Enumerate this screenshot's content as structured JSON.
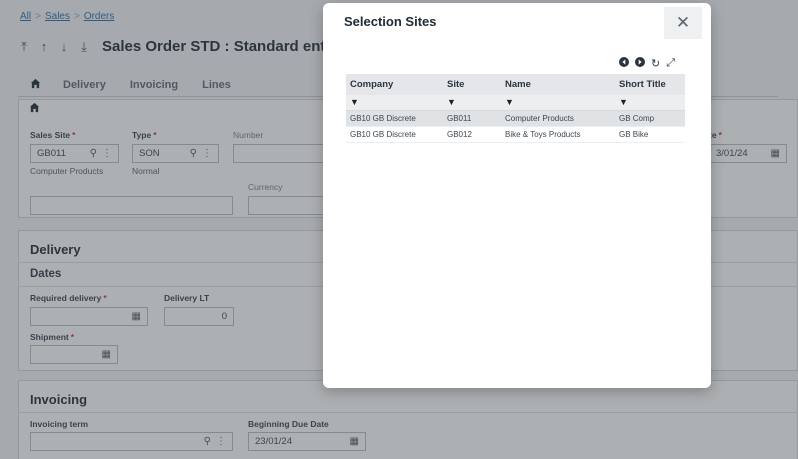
{
  "breadcrumb": {
    "all": "All",
    "sales": "Sales",
    "orders": "Orders",
    "sep": ">"
  },
  "header": {
    "title": "Sales Order STD : Standard entry"
  },
  "tabs": [
    {
      "label": "Delivery"
    },
    {
      "label": "Invoicing"
    },
    {
      "label": "Lines"
    }
  ],
  "form": {
    "sales_site_label": "Sales Site",
    "sales_site_value": "GB011",
    "sales_site_desc": "Computer Products",
    "type_label": "Type",
    "type_value": "SON",
    "type_desc": "Normal",
    "number_label": "Number",
    "currency_label": "Currency",
    "date_label": "te",
    "date_value": "3/01/24",
    "required_mark": "*"
  },
  "delivery": {
    "title": "Delivery",
    "dates_title": "Dates",
    "required_delivery_label": "Required delivery",
    "delivery_lt_label": "Delivery LT",
    "delivery_lt_value": "0",
    "shipment_label": "Shipment"
  },
  "invoicing": {
    "title": "Invoicing",
    "term_label": "Invoicing term",
    "due_date_label": "Beginning Due Date",
    "due_date_value": "23/01/24"
  },
  "dialog": {
    "title": "Selection Sites",
    "close": "✕",
    "columns": [
      "Company",
      "Site",
      "Name",
      "Short Title"
    ],
    "filter_glyph": "▼",
    "rows": [
      {
        "company": "GB10 GB Discrete",
        "site": "GB011",
        "name": "Computer Products",
        "short": "GB Comp"
      },
      {
        "company": "GB10 GB Discrete",
        "site": "GB012",
        "name": "Bike & Toys Products",
        "short": "GB Bike"
      }
    ]
  },
  "icons": {
    "prev": "arrow-left-circle-icon",
    "next": "arrow-right-circle-icon",
    "refresh": "refresh-icon",
    "expand": "expand-icon",
    "search": "search-icon",
    "kebab": "kebab-icon",
    "calendar": "calendar-icon",
    "home": "home-icon"
  },
  "colors": {
    "accent": "#007e45",
    "required": "#d7263d",
    "link": "#2b6fa8"
  }
}
